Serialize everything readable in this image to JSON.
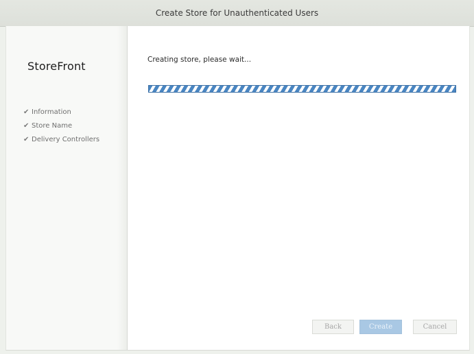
{
  "window": {
    "title": "Create Store for Unauthenticated Users"
  },
  "sidebar": {
    "brand": "StoreFront",
    "steps": [
      {
        "label": "Information",
        "icon": "checkmark-icon",
        "completed": true
      },
      {
        "label": "Store Name",
        "icon": "checkmark-icon",
        "completed": true
      },
      {
        "label": "Delivery Controllers",
        "icon": "checkmark-icon",
        "completed": true
      }
    ]
  },
  "main": {
    "status_text": "Creating store, please wait...",
    "progress": {
      "state": "indeterminate",
      "color": "#4a86c2"
    }
  },
  "buttons": {
    "back": {
      "label": "Back",
      "enabled": false
    },
    "create": {
      "label": "Create",
      "enabled": false
    },
    "cancel": {
      "label": "Cancel",
      "enabled": false
    }
  },
  "colors": {
    "accent": "#4a86c2",
    "disabled_text": "#a6a6a6"
  }
}
